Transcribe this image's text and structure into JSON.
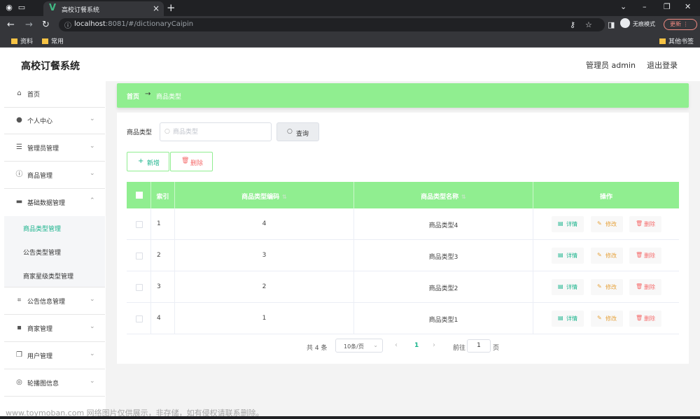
{
  "browser": {
    "tab_title": "高校订餐系统",
    "url_host": "localhost",
    "url_path": ":8081/#/dictionaryCaipin",
    "incognito_label": "无痕模式",
    "update_label": "更新",
    "bookmarks": [
      "资料",
      "常用"
    ],
    "other_bookmarks": "其他书签"
  },
  "header": {
    "brand": "高校订餐系统",
    "user": "管理员 admin",
    "logout": "退出登录"
  },
  "sidebar": {
    "items": [
      {
        "label": "首页",
        "icon": "home-icon"
      },
      {
        "label": "个人中心",
        "icon": "person-icon"
      },
      {
        "label": "管理员管理",
        "icon": "sliders-icon"
      },
      {
        "label": "商品管理",
        "icon": "info-icon"
      },
      {
        "label": "基础数据管理",
        "icon": "ticket-icon"
      },
      {
        "label": "公告信息管理",
        "icon": "crop-icon"
      },
      {
        "label": "商家管理",
        "icon": "printer-icon"
      },
      {
        "label": "用户管理",
        "icon": "copy-icon"
      },
      {
        "label": "轮播图信息",
        "icon": "target-icon"
      }
    ],
    "submenu": [
      {
        "label": "商品类型管理",
        "active": true
      },
      {
        "label": "公告类型管理",
        "active": false
      },
      {
        "label": "商家星级类型管理",
        "active": false
      }
    ]
  },
  "breadcrumb": {
    "home": "首页",
    "separator": "→",
    "current": "商品类型"
  },
  "search": {
    "label": "商品类型",
    "placeholder": "商品类型",
    "button": "查询"
  },
  "actions": {
    "add": "新增",
    "delete": "删除"
  },
  "table": {
    "columns": [
      "索引",
      "商品类型编码",
      "商品类型名称",
      "操作"
    ],
    "rows": [
      {
        "index": "1",
        "code": "4",
        "name": "商品类型4"
      },
      {
        "index": "2",
        "code": "3",
        "name": "商品类型3"
      },
      {
        "index": "3",
        "code": "2",
        "name": "商品类型2"
      },
      {
        "index": "4",
        "code": "1",
        "name": "商品类型1"
      }
    ],
    "ops": {
      "detail": "详情",
      "edit": "修改",
      "delete": "删除"
    }
  },
  "pagination": {
    "total": "共 4 条",
    "page_size": "10条/页",
    "current_page": "1",
    "goto_label": "前往",
    "goto_value": "1",
    "page_suffix": "页"
  },
  "watermark": "www.toymoban.com 网络图片仅供展示，非存储，如有侵权请联系删除。",
  "colors": {
    "accent": "#90ee90",
    "active_text": "#19b38b",
    "edit": "#e6a23c",
    "danger": "#f56c6c"
  }
}
